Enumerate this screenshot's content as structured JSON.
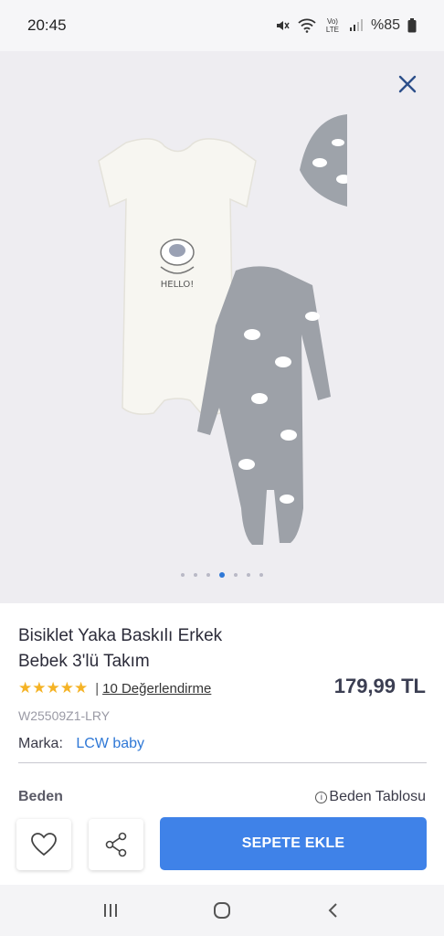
{
  "status_bar": {
    "time": "20:45",
    "network": "Vo) LTE",
    "battery": "%85",
    "icons": [
      "mute-icon",
      "wifi-icon",
      "signal-icon",
      "battery-icon"
    ]
  },
  "gallery": {
    "close_icon": "close-icon",
    "dot_count": 7,
    "active_dot": 3,
    "bodysuit_print": "HELLO!"
  },
  "product": {
    "title_line1": "Bisiklet Yaka Baskılı Erkek",
    "title_line2": "Bebek 3'lü Takım",
    "stars": "★★★★★",
    "rating_separator": "|",
    "rating_link": "10 Değerlendirme",
    "rating_value": 5,
    "price": "179,99 TL",
    "sku": "W25509Z1-LRY",
    "brand_label": "Marka:",
    "brand_value": "LCW baby",
    "size_label": "Beden",
    "size_chart_label": "Beden Tablosu"
  },
  "actions": {
    "add_to_cart_label": "SEPETE EKLE",
    "favorite_icon": "heart-icon",
    "share_icon": "share-icon"
  },
  "nav_bar": {
    "icons": [
      "recent-apps-icon",
      "home-icon",
      "back-icon"
    ]
  },
  "colors": {
    "accent": "#3f82e8",
    "brand_link": "#2f78d6",
    "star": "#f5b325",
    "gallery_bg": "#eeedf1"
  }
}
